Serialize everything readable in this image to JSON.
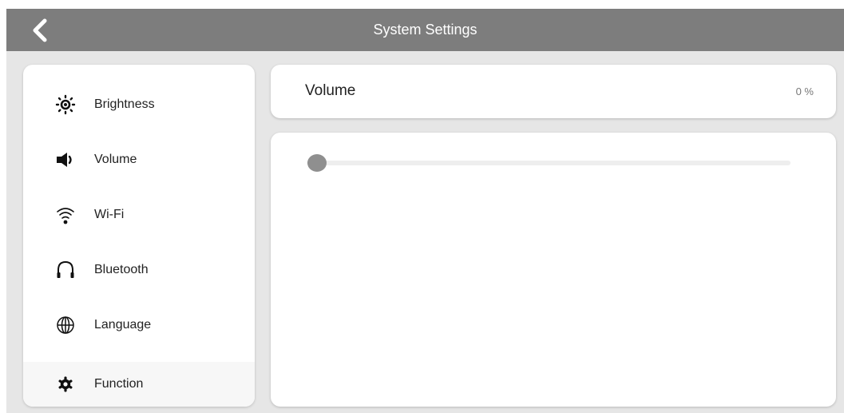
{
  "header": {
    "title": "System Settings",
    "back_icon": "chevron-left-icon"
  },
  "sidebar": {
    "items": [
      {
        "label": "Brightness",
        "icon": "brightness-icon",
        "selected": false
      },
      {
        "label": "Volume",
        "icon": "speaker-icon",
        "selected": false
      },
      {
        "label": "Wi-Fi",
        "icon": "wifi-icon",
        "selected": false
      },
      {
        "label": "Bluetooth",
        "icon": "headphones-icon",
        "selected": false
      },
      {
        "label": "Language",
        "icon": "globe-icon",
        "selected": false
      },
      {
        "label": "Function",
        "icon": "gear-icon",
        "selected": true
      }
    ]
  },
  "volume_panel": {
    "title": "Volume",
    "value_text": "0 %",
    "level": 0
  },
  "colors": {
    "topbar": "#7d7d7d",
    "background": "#e6e6e6",
    "card": "#ffffff",
    "accent": "#8f8f8f"
  }
}
